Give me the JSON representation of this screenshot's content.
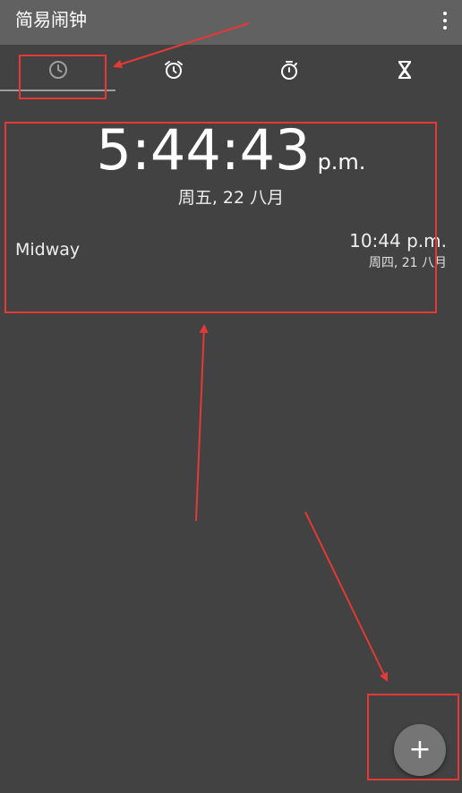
{
  "app_bar": {
    "title": "简易闹钟",
    "overflow_icon": "more-vert-icon",
    "background": "#616161"
  },
  "tabs": [
    {
      "name": "clock",
      "icon": "clock-icon",
      "selected": true
    },
    {
      "name": "alarm",
      "icon": "alarm-icon",
      "selected": false
    },
    {
      "name": "stopwatch",
      "icon": "stopwatch-icon",
      "selected": false
    },
    {
      "name": "timer",
      "icon": "hourglass-icon",
      "selected": false
    }
  ],
  "clock": {
    "time": "5:44:43",
    "ampm": "p.m.",
    "date": "周五, 22 八月"
  },
  "world_clocks": [
    {
      "city": "Midway",
      "time": "10:44 p.m.",
      "date": "周四, 21 八月"
    }
  ],
  "fab": {
    "label": "+",
    "icon": "add-icon"
  },
  "colors": {
    "background": "#424242",
    "text": "#ffffff",
    "annotation": "#e53935",
    "fab": "#757575"
  }
}
